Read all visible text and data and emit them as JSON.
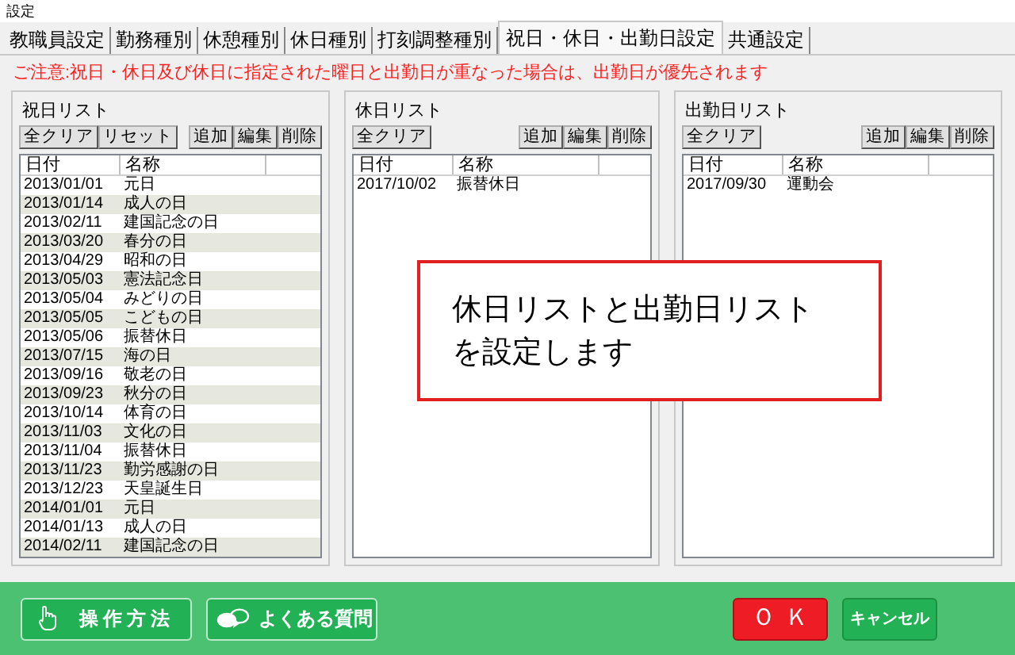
{
  "window": {
    "title": "設定"
  },
  "tabs": [
    {
      "label": "教職員設定",
      "selected": false
    },
    {
      "label": "勤務種別",
      "selected": false
    },
    {
      "label": "休憩種別",
      "selected": false
    },
    {
      "label": "休日種別",
      "selected": false
    },
    {
      "label": "打刻調整種別",
      "selected": false
    },
    {
      "label": "祝日・休日・出勤日設定",
      "selected": true
    },
    {
      "label": "共通設定",
      "selected": false
    }
  ],
  "notice": "ご注意:祝日・休日及び休日に指定された曜日と出勤日が重なった場合は、出勤日が優先されます",
  "panels": [
    {
      "title": "祝日リスト",
      "buttons_left": [
        "全クリア",
        "リセット"
      ],
      "buttons_right": [
        "追加",
        "編集",
        "削除"
      ],
      "columns": [
        "日付",
        "名称"
      ],
      "rows": [
        [
          "2013/01/01",
          "元日"
        ],
        [
          "2013/01/14",
          "成人の日"
        ],
        [
          "2013/02/11",
          "建国記念の日"
        ],
        [
          "2013/03/20",
          "春分の日"
        ],
        [
          "2013/04/29",
          "昭和の日"
        ],
        [
          "2013/05/03",
          "憲法記念日"
        ],
        [
          "2013/05/04",
          "みどりの日"
        ],
        [
          "2013/05/05",
          "こどもの日"
        ],
        [
          "2013/05/06",
          "振替休日"
        ],
        [
          "2013/07/15",
          "海の日"
        ],
        [
          "2013/09/16",
          "敬老の日"
        ],
        [
          "2013/09/23",
          "秋分の日"
        ],
        [
          "2013/10/14",
          "体育の日"
        ],
        [
          "2013/11/03",
          "文化の日"
        ],
        [
          "2013/11/04",
          "振替休日"
        ],
        [
          "2013/11/23",
          "勤労感謝の日"
        ],
        [
          "2013/12/23",
          "天皇誕生日"
        ],
        [
          "2014/01/01",
          "元日"
        ],
        [
          "2014/01/13",
          "成人の日"
        ],
        [
          "2014/02/11",
          "建国記念の日"
        ]
      ]
    },
    {
      "title": "休日リスト",
      "buttons_left": [
        "全クリア"
      ],
      "buttons_right": [
        "追加",
        "編集",
        "削除"
      ],
      "columns": [
        "日付",
        "名称"
      ],
      "rows": [
        [
          "2017/10/02",
          "振替休日"
        ]
      ]
    },
    {
      "title": "出勤日リスト",
      "buttons_left": [
        "全クリア"
      ],
      "buttons_right": [
        "追加",
        "編集",
        "削除"
      ],
      "columns": [
        "日付",
        "名称"
      ],
      "rows": [
        [
          "2017/09/30",
          "運動会"
        ]
      ]
    }
  ],
  "callout": [
    "休日リストと出勤日リスト",
    "を設定します"
  ],
  "footer": {
    "help_button": "操作方法",
    "faq_button": "よくある質問",
    "ok_button": "ＯＫ",
    "cancel_button": "キャンセル"
  }
}
